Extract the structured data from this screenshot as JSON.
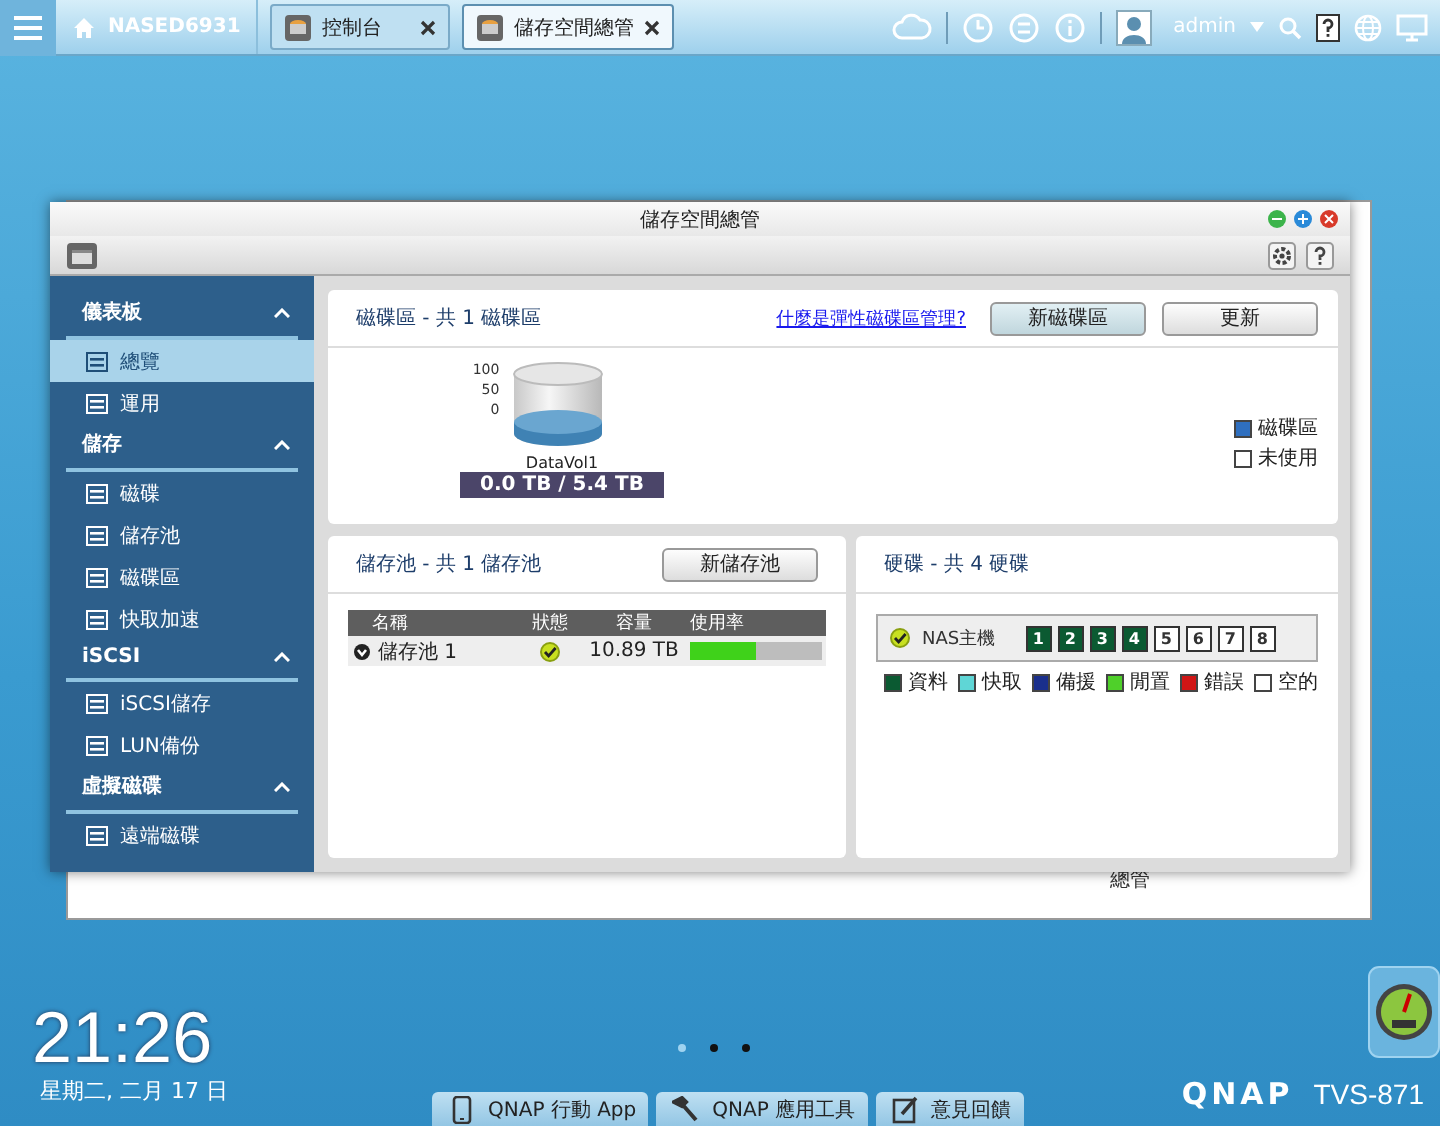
{
  "taskbar": {
    "host": "NASED6931",
    "tabs": [
      {
        "label": "控制台",
        "selected": false
      },
      {
        "label": "儲存空間總管",
        "selected": true
      }
    ],
    "user": "admin"
  },
  "background_window": {
    "text": "總管"
  },
  "window": {
    "title": "儲存空間總管"
  },
  "sidebar": {
    "sections": [
      {
        "title": "儀表板",
        "expanded": true,
        "items": [
          {
            "label": "總覽",
            "selected": true
          },
          {
            "label": "運用",
            "selected": false
          }
        ]
      },
      {
        "title": "儲存",
        "expanded": true,
        "items": [
          {
            "label": "磁碟",
            "selected": false
          },
          {
            "label": "儲存池",
            "selected": false
          },
          {
            "label": "磁碟區",
            "selected": false
          },
          {
            "label": "快取加速",
            "selected": false
          }
        ]
      },
      {
        "title": "iSCSI",
        "expanded": true,
        "items": [
          {
            "label": "iSCSI儲存",
            "selected": false
          },
          {
            "label": "LUN備份",
            "selected": false
          }
        ]
      },
      {
        "title": "虛擬磁碟",
        "expanded": true,
        "items": [
          {
            "label": "遠端磁碟",
            "selected": false
          }
        ]
      }
    ]
  },
  "volumes": {
    "title": "磁碟區 - 共 1 磁碟區",
    "help_link": "什麼是彈性磁碟區管理?",
    "buttons": [
      "新磁碟區",
      "更新"
    ],
    "axis_labels": [
      "100",
      "50",
      "0"
    ],
    "volume": {
      "name": "DataVol1",
      "usage": "0.0 TB / 5.4 TB"
    },
    "legend": [
      {
        "label": "磁碟區",
        "color": "#2f6fbf"
      },
      {
        "label": "未使用",
        "color": "#ffffff"
      }
    ]
  },
  "pools": {
    "title": "儲存池 - 共 1 儲存池",
    "button": "新儲存池",
    "columns": [
      "名稱",
      "狀態",
      "容量",
      "使用率"
    ],
    "rows": [
      {
        "name": "儲存池 1",
        "capacity": "10.89 TB",
        "level": 0.5
      }
    ]
  },
  "disks": {
    "title": "硬碟  - 共 4 硬碟",
    "enclosure": "NAS主機",
    "slots": [
      {
        "label": "1",
        "kind": "data"
      },
      {
        "label": "2",
        "kind": "data"
      },
      {
        "label": "3",
        "kind": "data"
      },
      {
        "label": "4",
        "kind": "data"
      },
      {
        "label": "5",
        "kind": "empty"
      },
      {
        "label": "6",
        "kind": "empty"
      },
      {
        "label": "7",
        "kind": "empty"
      },
      {
        "label": "8",
        "kind": "empty"
      }
    ],
    "legend": [
      {
        "label": "資料",
        "color": "#0b5a32"
      },
      {
        "label": "快取",
        "color": "#5fd6d6"
      },
      {
        "label": "備援",
        "color": "#1a2f8c"
      },
      {
        "label": "閒置",
        "color": "#4fd02a"
      },
      {
        "label": "錯誤",
        "color": "#d01515"
      },
      {
        "label": "空的",
        "color": "#ffffff"
      }
    ]
  },
  "desktop": {
    "time": "21:26",
    "date": "星期二, 二月 17 日",
    "pages": [
      {
        "selected": true
      },
      {
        "selected": false
      },
      {
        "selected": false
      }
    ],
    "dock": [
      "QNAP 行動 App",
      "QNAP 應用工具",
      "意見回饋"
    ],
    "brand": "QNAP",
    "model": "TVS-871"
  }
}
